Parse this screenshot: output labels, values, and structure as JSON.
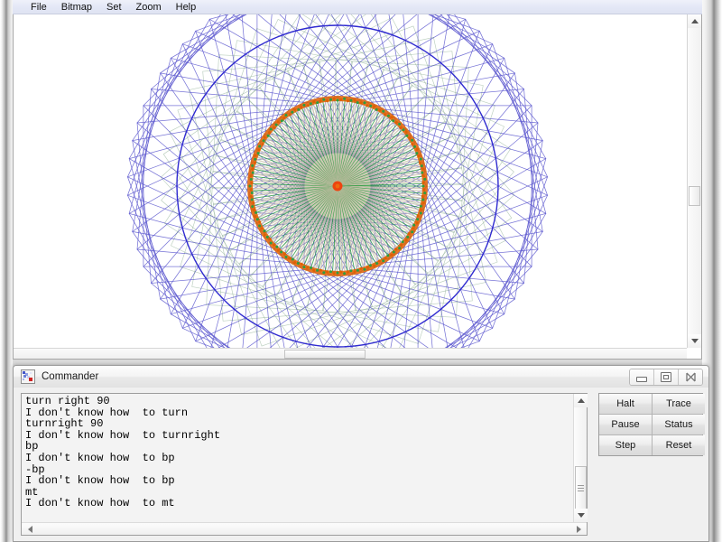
{
  "app": {
    "menu": [
      {
        "label": "File"
      },
      {
        "label": "Bitmap"
      },
      {
        "label": "Set"
      },
      {
        "label": "Zoom"
      },
      {
        "label": "Help"
      }
    ]
  },
  "canvas": {
    "background": "#ffffff",
    "graphic_description": "turtle-graphics spirograph: large blue rotated-square rosette ring enclosing a green/orange radial starburst disc with red center",
    "colors": {
      "outer_rosette": "#3a35c4",
      "mid_rosette": "#2f6b3a",
      "inner_spokes_green": "#2e9c3f",
      "inner_spokes_tan": "#c8bfa8",
      "ring": "#e06000",
      "center": "#ee3b0a"
    }
  },
  "commander": {
    "title": "Commander",
    "icon": "logo-turtle-icon",
    "window_buttons": [
      {
        "name": "minimize",
        "glyph": "–"
      },
      {
        "name": "maximize",
        "glyph": "□"
      },
      {
        "name": "close",
        "glyph": "✕"
      }
    ],
    "console_lines": [
      "turn right 90",
      "I don't know how  to turn",
      "turnright 90",
      "I don't know how  to turnright",
      "bp",
      "I don't know how  to bp",
      "-bp",
      "I don't know how  to bp",
      "mt",
      "I don't know how  to mt"
    ],
    "buttons": [
      {
        "label": "Halt"
      },
      {
        "label": "Trace"
      },
      {
        "label": "Pause"
      },
      {
        "label": "Status"
      },
      {
        "label": "Step"
      },
      {
        "label": "Reset"
      }
    ]
  }
}
